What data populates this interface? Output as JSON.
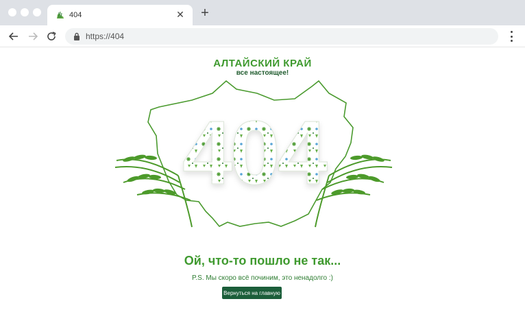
{
  "browser": {
    "tab": {
      "title": "404",
      "favicon": "altai-wheat-icon"
    },
    "url": "https://404",
    "icons": {
      "back": "arrow-left-icon",
      "forward": "arrow-right-icon",
      "reload": "reload-icon",
      "lock": "lock-icon",
      "menu": "kebab-menu-icon",
      "new_tab": "plus-icon",
      "close_tab": "close-icon"
    }
  },
  "page": {
    "logo": {
      "title": "АЛТАЙСКИЙ КРАЙ",
      "subtitle": "все настоящее!"
    },
    "error_code": "404",
    "headline": "Ой, что-то пошло не так...",
    "ps": "P.S. Мы скоро всё починим, это ненадолго :)",
    "home_button": "Вернуться на главную",
    "colors": {
      "brand_green": "#3f9a2f",
      "dark_green": "#1b5e3a",
      "outline_green": "#4a9a2e",
      "accent_blue": "#5aa6d6"
    }
  }
}
